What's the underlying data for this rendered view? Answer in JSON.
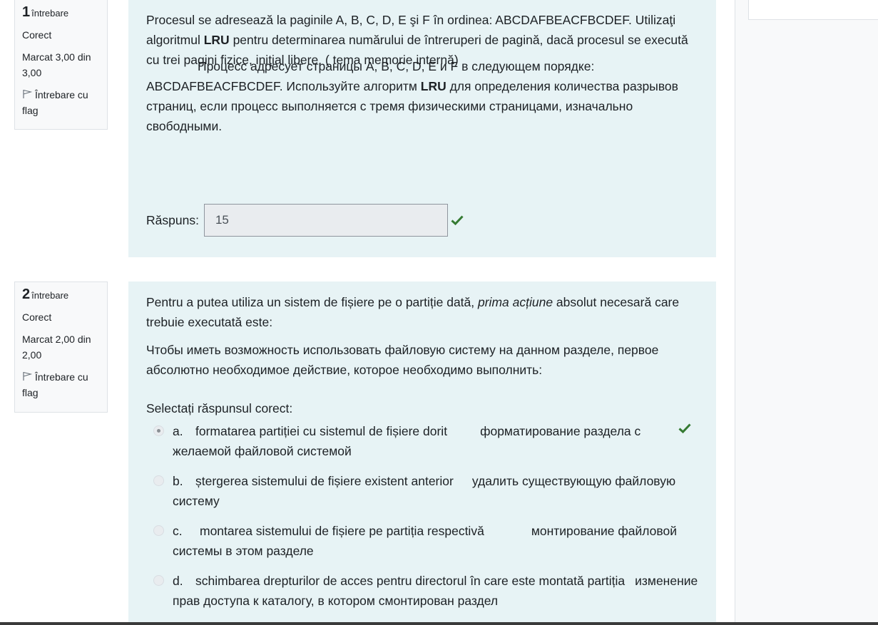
{
  "questions": [
    {
      "number": "1",
      "question_word": "întrebare",
      "state": "Corect",
      "grade": "Marcat 3,00 din 3,00",
      "flag_label": "Întrebare cu flag",
      "text_ro_1": "Procesul se adresează la paginile A, B, C, D, E şi F în ordinea:  ABCDAFBEACFBCDEF. Utilizaţi algoritmul ",
      "text_ro_bold": "LRU",
      "text_ro_2": " pentru determinarea numărului de întreruperi de pagină, dacă procesul se execută cu trei pagini fizice, iniţial libere.       ( tema memorie internă)",
      "text_ru_1": "Процесс адресует страницы A, B, C, D, E и F в следующем порядке: ABCDAFBEACFBCDEF. Используйте алгоритм ",
      "text_ru_bold": "LRU",
      "text_ru_2": " для определения количества разрывов страниц, если процесс выполняется с тремя физическими страницами, изначально свободными.",
      "answer_label": "Răspuns:",
      "answer_value": "15"
    },
    {
      "number": "2",
      "question_word": "întrebare",
      "state": "Corect",
      "grade": "Marcat 2,00 din 2,00",
      "flag_label": "Întrebare cu flag",
      "text_ro_1": "Pentru a putea utiliza un sistem de fișiere pe o partiție dată, ",
      "text_ro_italic": "prima acțiune",
      "text_ro_2": " absolut necesară care trebuie executată este:",
      "text_ru": "Чтобы иметь возможность использовать файловую систему на данном разделе, первое абсолютно необходимое действие, которое необходимо выполнить:",
      "prompt": "Selectați răspunsul corect:",
      "options": [
        {
          "letter": "a.",
          "ro": "formatarea partiției cu sistemul de fișiere dorit",
          "ru": "форматирование раздела с желаемой файловой системой",
          "selected": true,
          "correct": true
        },
        {
          "letter": "b.",
          "ro": "ștergerea sistemului de fișiere existent anterior",
          "ru": "удалить существующую файловую систему",
          "selected": false,
          "correct": false
        },
        {
          "letter": "c.",
          "ro": "montarea sistemului de fișiere pe partiția respectivă",
          "ru": "монтирование файловой системы в этом разделе",
          "selected": false,
          "correct": false
        },
        {
          "letter": "d.",
          "ro": "schimbarea drepturilor de acces pentru directorul în care este montată partiția",
          "ru": "изменение прав доступа к каталогу, в котором смонтирован раздел",
          "selected": false,
          "correct": false
        }
      ]
    }
  ],
  "colors": {
    "content_bg": "#e7f3f5",
    "info_bg": "#f8f9fa",
    "correct_green": "#357a32"
  },
  "icons": {
    "flag": "flag-icon",
    "correct": "check-icon"
  }
}
